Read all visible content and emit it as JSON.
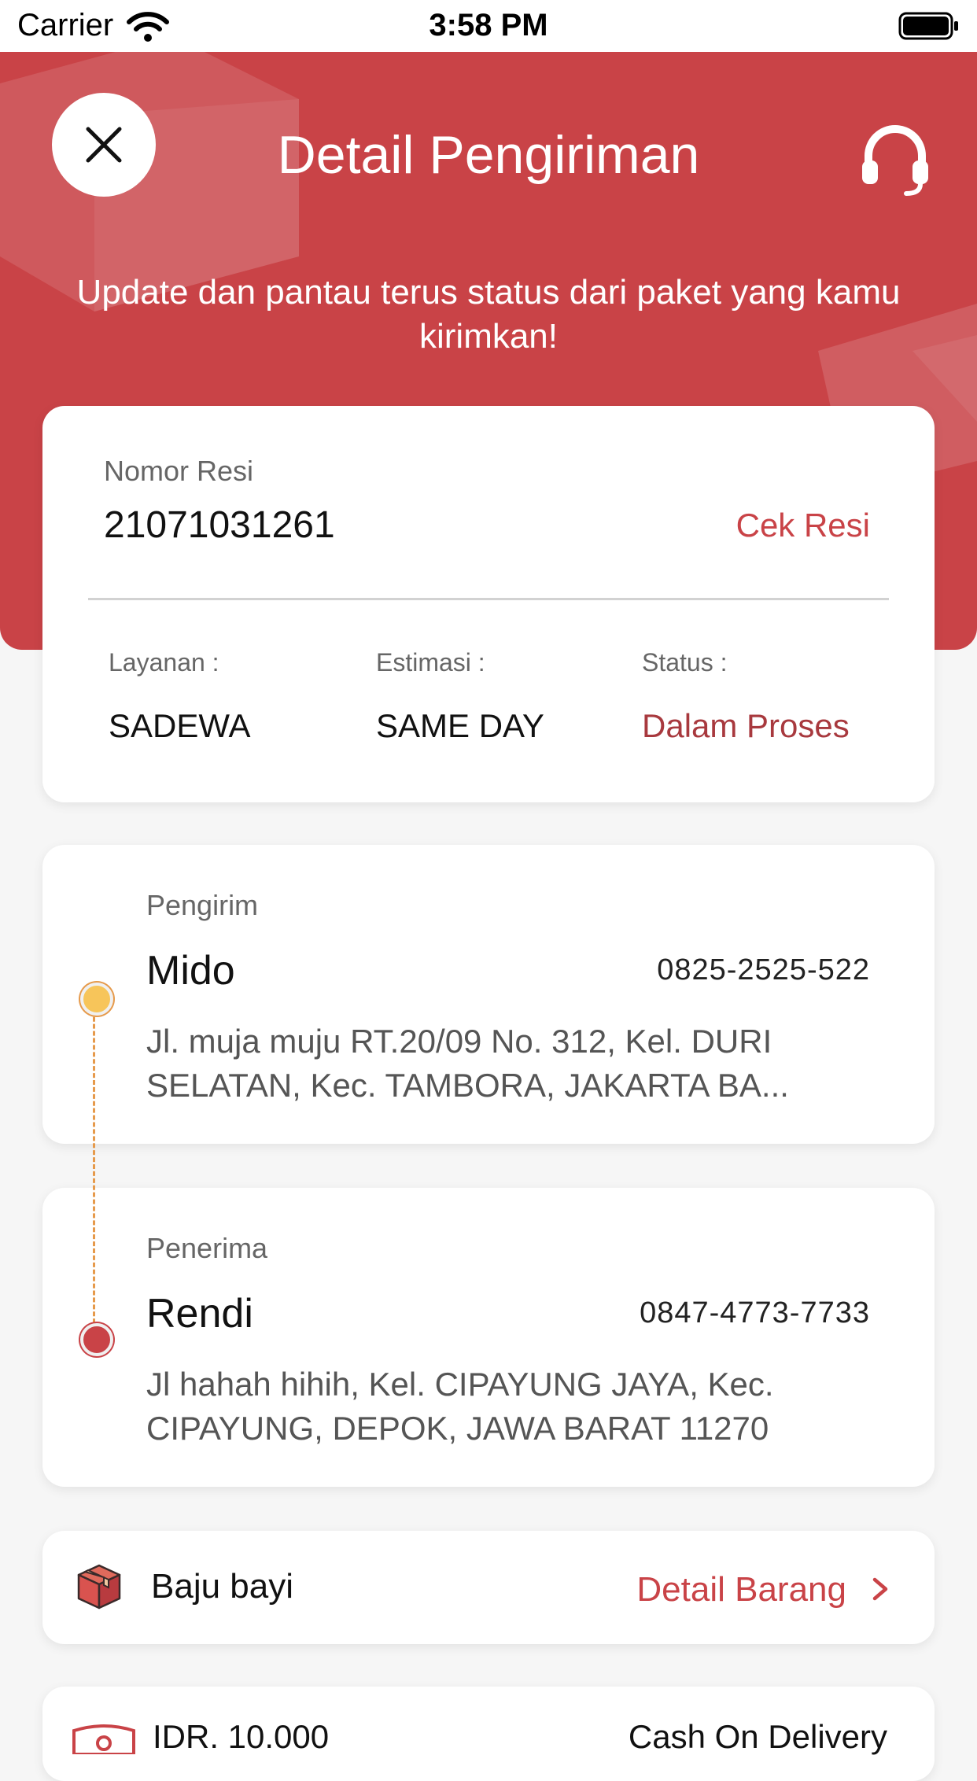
{
  "status_bar": {
    "carrier": "Carrier",
    "time": "3:58 PM"
  },
  "header": {
    "title": "Detail Pengiriman",
    "subtitle": "Update dan pantau terus status dari paket yang kamu kirimkan!",
    "background_color": "#c94347"
  },
  "resi": {
    "label": "Nomor Resi",
    "number": "21071031261",
    "check_label": "Cek Resi",
    "service_label": "Layanan :",
    "service_value": "SADEWA",
    "estimate_label": "Estimasi :",
    "estimate_value": "SAME DAY",
    "status_label": "Status :",
    "status_value": "Dalam Proses"
  },
  "sender": {
    "role": "Pengirim",
    "name": "Mido",
    "phone": "0825-2525-522",
    "address": "Jl. muja muju RT.20/09 No. 312, Kel. DURI SELATAN, Kec. TAMBORA, JAKARTA BA..."
  },
  "receiver": {
    "role": "Penerima",
    "name": "Rendi",
    "phone": "0847-4773-7733",
    "address": "Jl hahah hihih, Kel. CIPAYUNG JAYA, Kec. CIPAYUNG, DEPOK, JAWA BARAT 11270"
  },
  "item": {
    "name": "Baju bayi",
    "detail_label": "Detail Barang",
    "icon": "package-icon"
  },
  "payment": {
    "amount": "IDR. 10.000",
    "method": "Cash On Delivery",
    "icon": "cash-icon"
  },
  "colors": {
    "accent": "#c94347",
    "status": "#a8393e",
    "sender_dot": "#f7c55a"
  }
}
